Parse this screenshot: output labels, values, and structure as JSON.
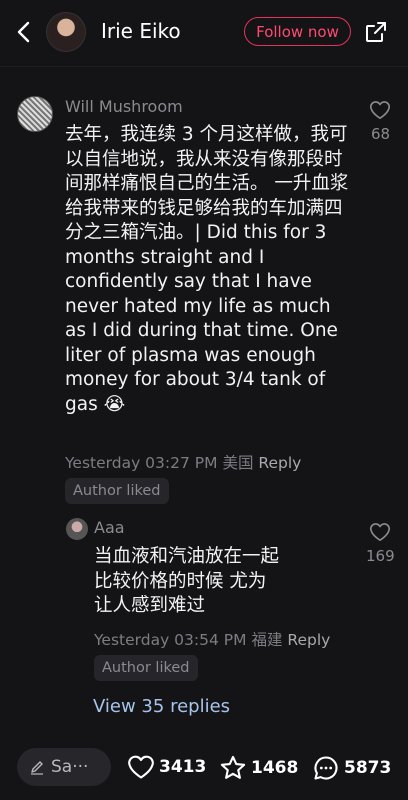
{
  "header": {
    "title": "Irie Eiko",
    "follow_label": "Follow now"
  },
  "comment": {
    "author": "Will Mushroom",
    "text": "去年，我连续 3 个月这样做，我可以自信地说，我从来没有像那段时间那样痛恨自己的生活。 一升血浆给我带来的钱足够给我的车加满四分之三箱汽油。| Did this for 3 months straight and I confidently say that I have never hated my life as much as I did during that time. One liter of plasma was enough money for about 3/4 tank of gas",
    "emoji": "😭",
    "time": "Yesterday 03:27 PM",
    "location": "美国",
    "reply_label": "Reply",
    "likes": "68",
    "author_liked": "Author liked"
  },
  "reply": {
    "author": "Aaa",
    "text": "当血液和汽油放在一起比较价格的时候 尤为让人感到难过",
    "time": "Yesterday 03:54 PM",
    "location": "福建",
    "reply_label": "Reply",
    "likes": "169",
    "author_liked": "Author liked"
  },
  "view_replies": "View 35 replies",
  "bottom_bar": {
    "say_placeholder": "Sa···",
    "likes": "3413",
    "favorites": "1468",
    "comments": "5873"
  },
  "colors": {
    "background": "#141417",
    "accent": "#ff4a6e",
    "link": "#a6c4ea"
  }
}
